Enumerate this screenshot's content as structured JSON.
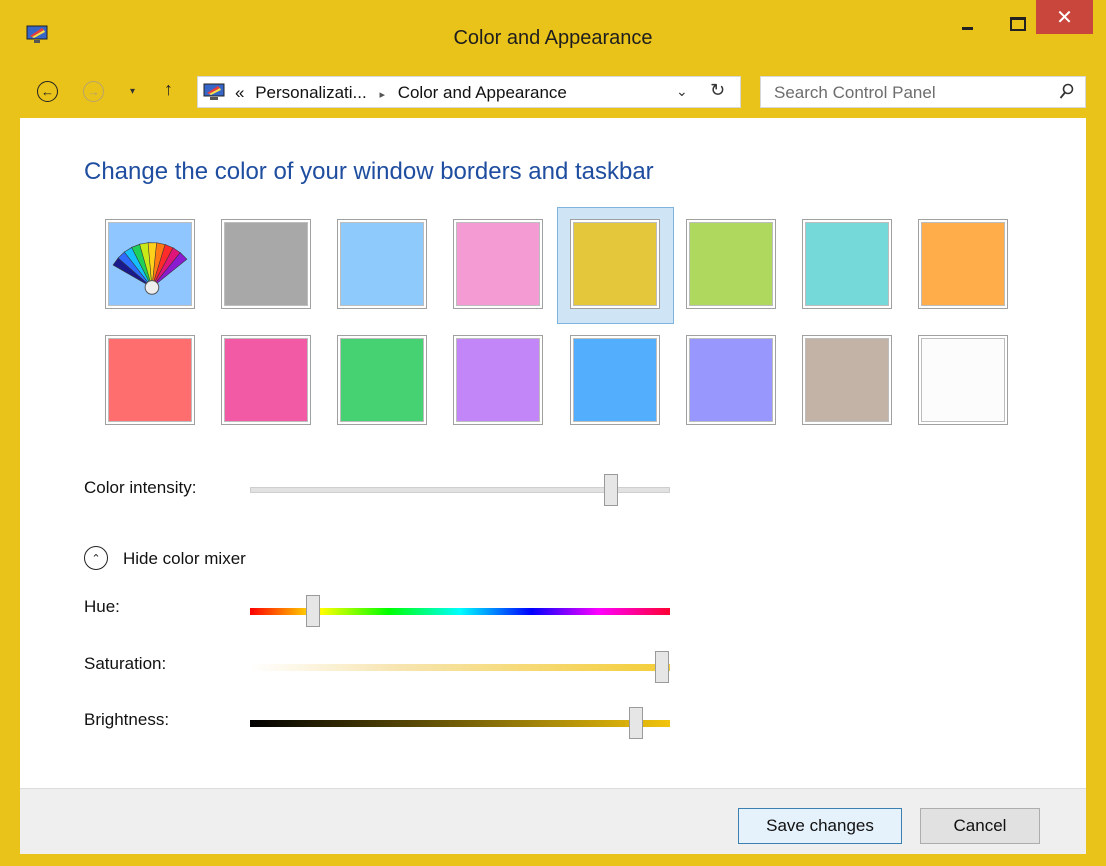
{
  "window": {
    "title": "Color and Appearance",
    "accent_color": "#e9c21a",
    "close_symbol": "✕"
  },
  "address": {
    "overflow_marker": "«",
    "crumbs": [
      "Personalizati...",
      "Color and Appearance"
    ],
    "separator": "▸",
    "dropdown_symbol": "⌄",
    "refresh_symbol": "↻"
  },
  "nav": {
    "back_symbol": "←",
    "forward_symbol": "→",
    "recent_symbol": "▾",
    "up_symbol": "↑"
  },
  "search": {
    "placeholder": "Search Control Panel"
  },
  "main": {
    "heading": "Change the color of your window borders and taskbar",
    "swatches": [
      {
        "name": "custom",
        "color": "#8fc6ff",
        "icon": "color-palette-fan-icon"
      },
      {
        "name": "gray",
        "color": "#a8a8a8"
      },
      {
        "name": "light-blue",
        "color": "#8ecbfc"
      },
      {
        "name": "pink",
        "color": "#f39bd2"
      },
      {
        "name": "yellow",
        "color": "#e4c73a",
        "selected": true
      },
      {
        "name": "green",
        "color": "#aed95e"
      },
      {
        "name": "teal",
        "color": "#76d9d9"
      },
      {
        "name": "orange",
        "color": "#ffad4a"
      },
      {
        "name": "red",
        "color": "#ff6e6e"
      },
      {
        "name": "magenta",
        "color": "#f25aa6"
      },
      {
        "name": "emerald",
        "color": "#46d173"
      },
      {
        "name": "violet",
        "color": "#c386f9"
      },
      {
        "name": "blue",
        "color": "#53aefd"
      },
      {
        "name": "periwinkle",
        "color": "#9897fe"
      },
      {
        "name": "taupe",
        "color": "#c3b3a6"
      },
      {
        "name": "white",
        "color": "#fcfcfc"
      }
    ],
    "intensity": {
      "label": "Color intensity:",
      "value": 0.86
    },
    "mixer_toggle": {
      "label": "Hide color mixer",
      "symbol": "⌃"
    },
    "hue": {
      "label": "Hue:",
      "value": 0.15
    },
    "saturation": {
      "label": "Saturation:",
      "value": 0.98
    },
    "brightness": {
      "label": "Brightness:",
      "value": 0.92
    }
  },
  "footer": {
    "save_label": "Save changes",
    "cancel_label": "Cancel"
  }
}
